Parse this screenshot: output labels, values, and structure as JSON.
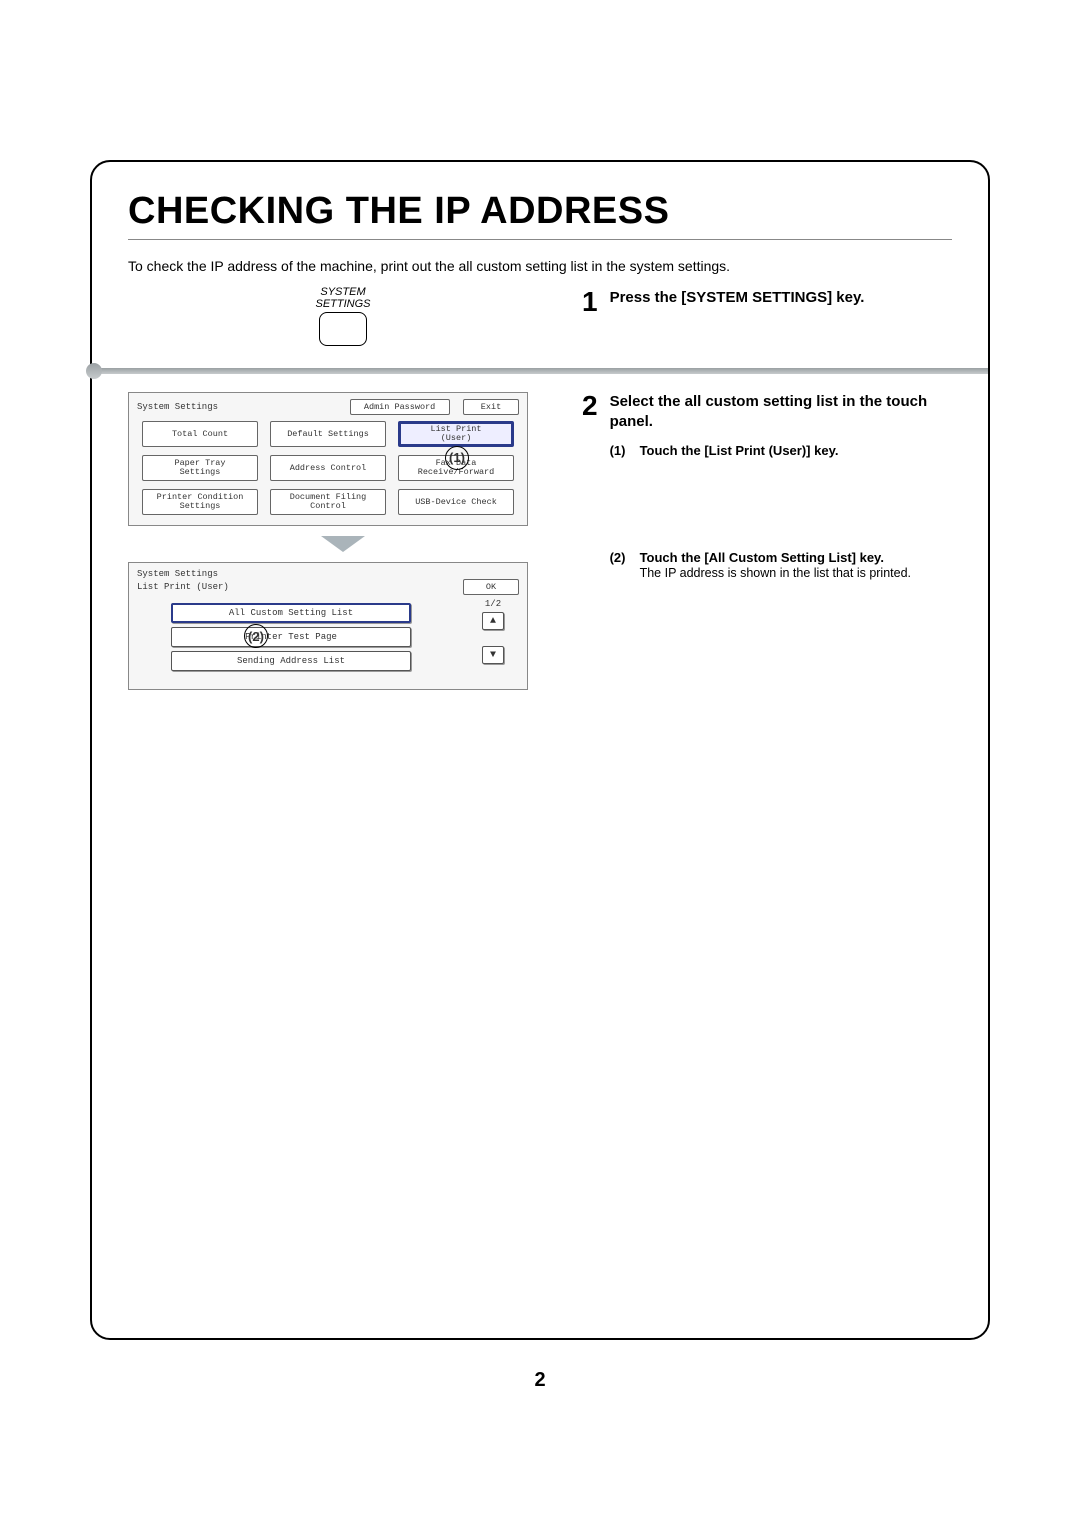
{
  "title": "CHECKING THE IP ADDRESS",
  "intro": "To check the IP address of the machine, print out the all custom setting list in the system settings.",
  "hwkey": {
    "line1": "SYSTEM",
    "line2": "SETTINGS"
  },
  "step1": {
    "num": "1",
    "text": "Press the [SYSTEM SETTINGS] key."
  },
  "panel1": {
    "header": "System Settings",
    "admin": "Admin Password",
    "exit": "Exit",
    "buttons": {
      "r1c1": "Total Count",
      "r1c2": "Default Settings",
      "r1c3": "List Print\n(User)",
      "r2c1": "Paper Tray\nSettings",
      "r2c2": "Address Control",
      "r2c3": "Fax Data\nReceive/Forward",
      "r3c1": "Printer Condition\nSettings",
      "r3c2": "Document Filing\nControl",
      "r3c3": "USB-Device Check"
    },
    "callout": "(1)"
  },
  "panel2": {
    "header": "System Settings",
    "sub": "List Print (User)",
    "ok": "OK",
    "pager": "1/2",
    "items": {
      "a": "All Custom Setting List",
      "b": "Printer Test Page",
      "c": "Sending Address List"
    },
    "callout": "(2)",
    "up": "▲",
    "down": "▼"
  },
  "step2": {
    "num": "2",
    "title": "Select the all custom setting list in the touch panel.",
    "sub1_num": "(1)",
    "sub1": "Touch the [List Print (User)] key.",
    "sub2_num": "(2)",
    "sub2": "Touch the [All Custom Setting List] key.",
    "sub2_text": "The IP address is shown in the list that is printed."
  },
  "page_number": "2"
}
